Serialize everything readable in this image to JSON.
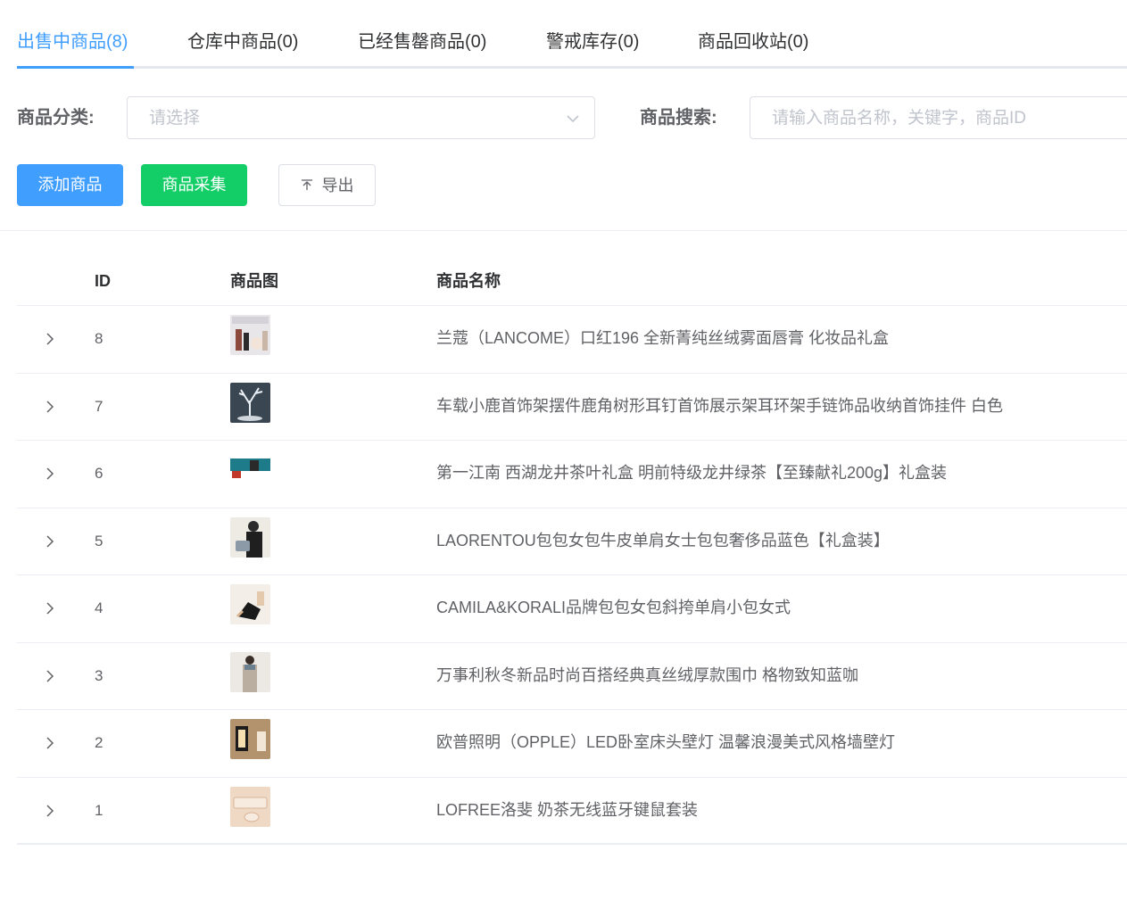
{
  "tabs": [
    {
      "label": "出售中商品(8)",
      "active": true
    },
    {
      "label": "仓库中商品(0)",
      "active": false
    },
    {
      "label": "已经售罄商品(0)",
      "active": false
    },
    {
      "label": "警戒库存(0)",
      "active": false
    },
    {
      "label": "商品回收站(0)",
      "active": false
    }
  ],
  "filters": {
    "category_label": "商品分类:",
    "category_placeholder": "请选择",
    "search_label": "商品搜索:",
    "search_placeholder": "请输入商品名称，关键字，商品ID"
  },
  "actions": {
    "add_label": "添加商品",
    "collect_label": "商品采集",
    "export_label": "导出"
  },
  "table": {
    "headers": {
      "id": "ID",
      "image": "商品图",
      "name": "商品名称"
    },
    "rows": [
      {
        "id": "8",
        "name": "兰蔻（LANCOME）口红196 全新菁纯丝绒雾面唇膏 化妆品礼盒",
        "thumb": "lipstick-giftbox"
      },
      {
        "id": "7",
        "name": "车载小鹿首饰架摆件鹿角树形耳钉首饰展示架耳环架手链饰品收纳首饰挂件 白色",
        "thumb": "deer-antler-jewelry-stand"
      },
      {
        "id": "6",
        "name": "第一江南 西湖龙井茶叶礼盒 明前特级龙井绿茶【至臻献礼200g】礼盒装",
        "thumb": "tea-giftbox"
      },
      {
        "id": "5",
        "name": "LAORENTOU包包女包牛皮单肩女士包包奢侈品蓝色【礼盒装】",
        "thumb": "woman-with-handbag"
      },
      {
        "id": "4",
        "name": "CAMILA&KORALI品牌包包女包斜挎单肩小包女式",
        "thumb": "shoulder-bag"
      },
      {
        "id": "3",
        "name": "万事利秋冬新品时尚百搭经典真丝绒厚款围巾 格物致知蓝咖",
        "thumb": "model-with-scarf"
      },
      {
        "id": "2",
        "name": "欧普照明（OPPLE）LED卧室床头壁灯 温馨浪漫美式风格墙壁灯",
        "thumb": "wall-lamp"
      },
      {
        "id": "1",
        "name": "LOFREE洛斐 奶茶无线蓝牙键鼠套装",
        "thumb": "keyboard-mouse-set"
      }
    ]
  },
  "colors": {
    "accent": "#409eff",
    "success": "#13ce66",
    "border": "#dcdfe6",
    "text": "#606266"
  }
}
